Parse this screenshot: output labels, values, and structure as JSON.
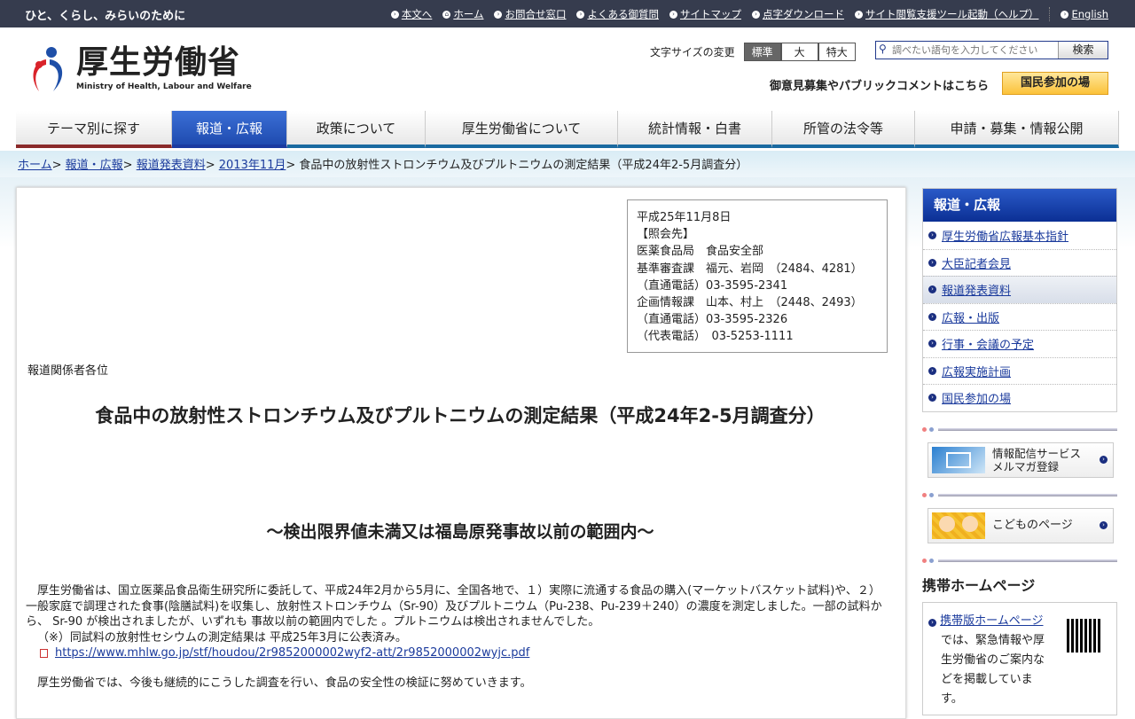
{
  "topbar": {
    "tagline": "ひと、くらし、みらいのために",
    "links": [
      "本文へ",
      "ホーム",
      "お問合せ窓口",
      "よくある御質問",
      "サイトマップ",
      "点字ダウンロード",
      "サイト閲覧支援ツール起動（ヘルプ）",
      "English"
    ]
  },
  "header": {
    "logo_jp": "厚生労働省",
    "logo_en": "Ministry of Health, Labour and Welfare",
    "font_size_label": "文字サイズの変更",
    "font_sizes": [
      "標準",
      "大",
      "特大"
    ],
    "search_placeholder": "調べたい語句を入力してください",
    "search_button": "検索",
    "opinion_text": "御意見募集やパブリックコメントはこちら",
    "kokumin_button": "国民参加の場"
  },
  "nav": [
    "テーマ別に探す",
    "報道・広報",
    "政策について",
    "厚生労働省について",
    "統計情報・白書",
    "所管の法令等",
    "申請・募集・情報公開"
  ],
  "breadcrumb": {
    "items": [
      "ホーム",
      "報道・広報",
      "報道発表資料",
      "2013年11月"
    ],
    "current": "食品中の放射性ストロンチウム及びプルトニウムの測定結果（平成24年2-5月調査分）"
  },
  "contact": [
    "平成25年11月8日",
    "【照会先】",
    "医薬食品局　食品安全部",
    "基準審査課　福元、岩岡　（2484、4281）",
    "（直通電話）03-3595-2341",
    "企画情報課　山本、村上　（2448、2493）",
    "（直通電話）03-3595-2326",
    "（代表電話）　03-5253-1111"
  ],
  "main": {
    "addressee": "報道関係者各位",
    "title": "食品中の放射性ストロンチウム及びプルトニウムの測定結果（平成24年2-5月調査分）",
    "subtitle": "～検出限界値未満又は福島原発事故以前の範囲内～",
    "para1": "厚生労働省は、国立医薬品食品衛生研究所に委託して、平成24年2月から5月に、全国各地で、１）実際に流通する食品の購入(マーケットバスケット試料)や、２）一般家庭で調理された食事(陰膳試料)を収集し、放射性ストロンチウム（Sr-90）及びプルトニウム（Pu-238、Pu-239＋240）の濃度を測定しました。一部の試料から、 Sr-90 が検出されましたが、いずれも 事故以前の範囲内でした 。プルトニウムは検出されませんでした。",
    "note": "（※）同試料の放射性セシウムの測定結果は 平成25年3月に公表済み。",
    "pdf_link": "https://www.mhlw.go.jp/stf/houdou/2r9852000002wyf2-att/2r9852000002wyjc.pdf",
    "para2": "厚生労働省では、今後も継続的にこうした調査を行い、食品の安全性の検証に努めていきます。"
  },
  "sidebar": {
    "heading": "報道・広報",
    "items": [
      "厚生労働省広報基本指針",
      "大臣記者会見",
      "報道発表資料",
      "広報・出版",
      "行事・会議の予定",
      "広報実施計画",
      "国民参加の場"
    ],
    "mail_banner": [
      "情報配信サービス",
      "メルマガ登録"
    ],
    "kids_banner": "こどものページ",
    "mobile_title": "携帯ホームページ",
    "mobile_link": "携帯版ホームページ",
    "mobile_text": "では、緊急情報や厚生労働省のご案内などを掲載しています。"
  }
}
